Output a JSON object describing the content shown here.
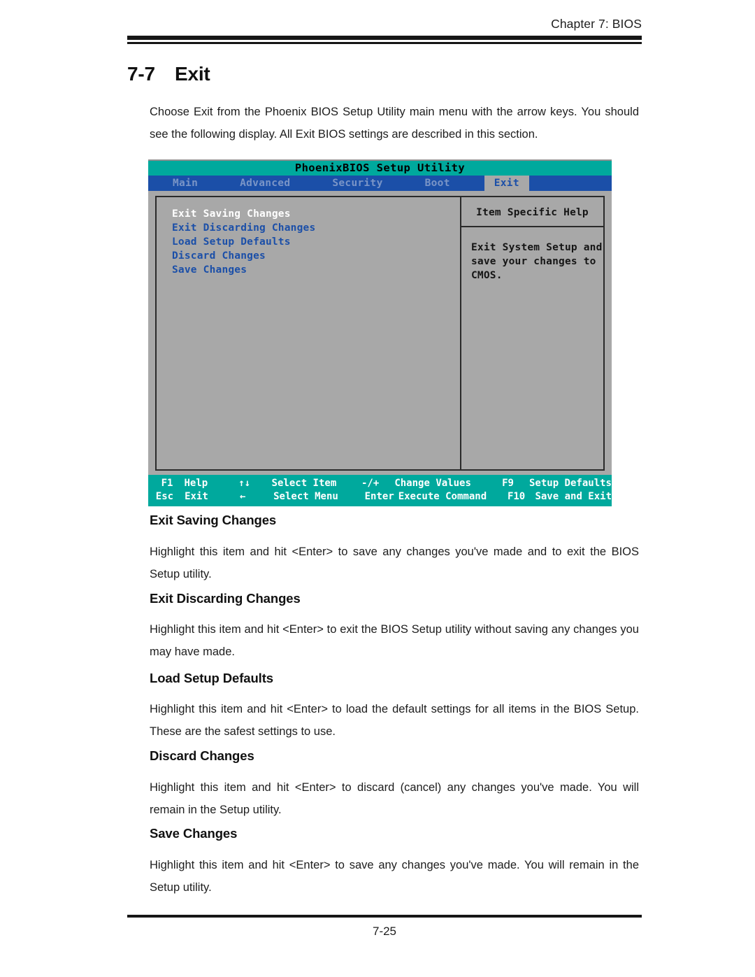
{
  "header": {
    "chapter": "Chapter 7: BIOS"
  },
  "section": {
    "number": "7-7",
    "title": "Exit"
  },
  "intro": "Choose Exit from the Phoenix BIOS Setup Utility main menu with the arrow keys. You should see the following display.  All Exit BIOS settings are described in this section.",
  "bios": {
    "title": "PhoenixBIOS Setup Utility",
    "menu": [
      {
        "label": "Main",
        "active": false
      },
      {
        "label": "Advanced",
        "active": false
      },
      {
        "label": "Security",
        "active": false
      },
      {
        "label": "Boot",
        "active": false
      },
      {
        "label": "Exit",
        "active": true
      }
    ],
    "items": [
      {
        "label": "Exit Saving Changes",
        "selected": true
      },
      {
        "label": "Exit Discarding Changes",
        "selected": false
      },
      {
        "label": "Load Setup Defaults",
        "selected": false
      },
      {
        "label": "Discard Changes",
        "selected": false
      },
      {
        "label": "Save Changes",
        "selected": false
      }
    ],
    "help": {
      "title": "Item Specific Help",
      "line1": "Exit System Setup and",
      "line2": "save your changes to",
      "line3": "CMOS."
    },
    "footer": {
      "row1": {
        "k1": "F1",
        "l1": "Help",
        "k2": "↑↓",
        "l2": "Select Item",
        "k3": "-/+",
        "l3": "Change Values",
        "k4": "F9",
        "l4": "Setup Defaults"
      },
      "row2": {
        "k1": "Esc",
        "l1": "Exit",
        "k2": "←",
        "l2": "Select Menu",
        "k3": "Enter",
        "l3": "Execute Command",
        "k4": "F10",
        "l4": "Save and Exit"
      }
    },
    "colors": {
      "title_bar": "#00a99d",
      "menu_bar": "#1b4fa8",
      "panel": "#a8a8a8",
      "item_text": "#1b4fa8",
      "selected_text": "#ffffff"
    }
  },
  "sections": [
    {
      "heading": "Exit Saving Changes",
      "body": "Highlight this item and hit <Enter> to save any changes you've made and to exit the BIOS Setup utility."
    },
    {
      "heading": "Exit Discarding Changes",
      "body": "Highlight this item and hit <Enter> to exit the BIOS Setup utility without saving any changes you may have made."
    },
    {
      "heading": "Load Setup Defaults",
      "body": "Highlight this item and hit <Enter> to load the default settings for all items in the BIOS Setup. These are the safest settings to use."
    },
    {
      "heading": "Discard Changes",
      "body": "Highlight this item and hit <Enter> to discard (cancel) any changes you've made. You will remain in the Setup utility."
    },
    {
      "heading": "Save Changes",
      "body": "Highlight this item and hit <Enter> to save any changes you've made.  You will remain in the Setup utility."
    }
  ],
  "footer": {
    "page_number": "7-25"
  }
}
